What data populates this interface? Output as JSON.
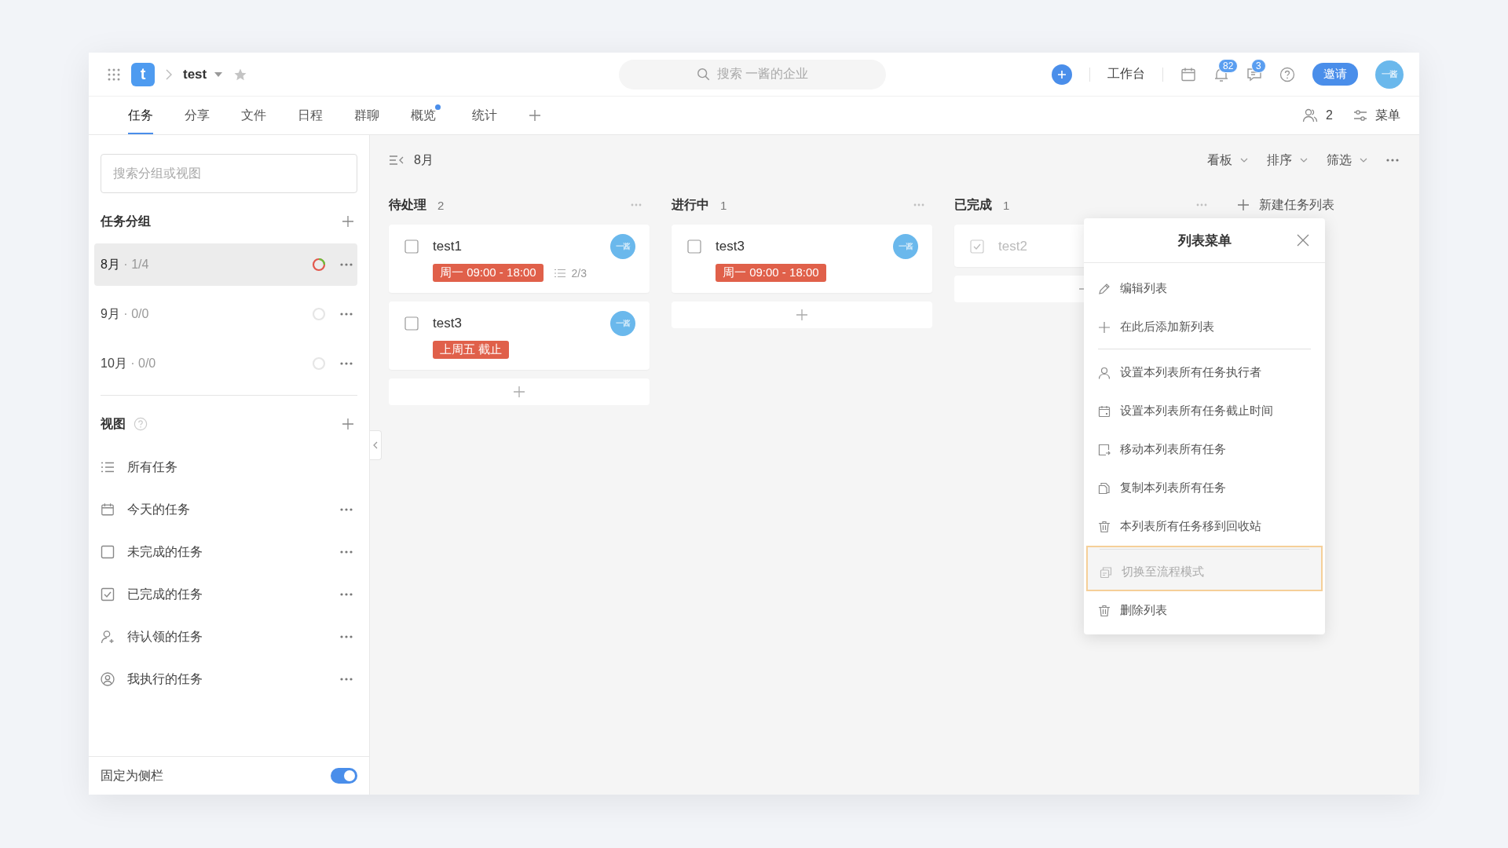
{
  "topbar": {
    "logo": "t",
    "project": "test",
    "search_placeholder": "搜索 一酱的企业",
    "workbench": "工作台",
    "notifications_badge": "82",
    "messages_badge": "3",
    "invite": "邀请",
    "avatar": "一酱"
  },
  "tabs": [
    {
      "label": "任务",
      "selected": true,
      "dot": false
    },
    {
      "label": "分享",
      "selected": false,
      "dot": false
    },
    {
      "label": "文件",
      "selected": false,
      "dot": false
    },
    {
      "label": "日程",
      "selected": false,
      "dot": false
    },
    {
      "label": "群聊",
      "selected": false,
      "dot": false
    },
    {
      "label": "概览",
      "selected": false,
      "dot": true
    },
    {
      "label": "统计",
      "selected": false,
      "dot": false
    }
  ],
  "members_count": "2",
  "menu_label": "菜单",
  "sidebar": {
    "search_placeholder": "搜索分组或视图",
    "groups_title": "任务分组",
    "groups": [
      {
        "name": "8月",
        "count": " · 1/4",
        "selected": true,
        "level": 0.25
      },
      {
        "name": "9月",
        "count": " · 0/0",
        "selected": false,
        "level": 0
      },
      {
        "name": "10月",
        "count": " · 0/0",
        "selected": false,
        "level": 0
      }
    ],
    "views_title": "视图",
    "views": [
      {
        "label": "所有任务",
        "kind": "list",
        "more": false
      },
      {
        "label": "今天的任务",
        "kind": "calendar",
        "more": true
      },
      {
        "label": "未完成的任务",
        "kind": "unchecked",
        "more": true
      },
      {
        "label": "已完成的任务",
        "kind": "checked",
        "more": true
      },
      {
        "label": "待认领的任务",
        "kind": "claim",
        "more": true
      },
      {
        "label": "我执行的任务",
        "kind": "person",
        "more": true
      }
    ],
    "pin": {
      "label": "固定为侧栏",
      "on": true
    }
  },
  "board": {
    "title": "8月",
    "view": "看板",
    "sort": "排序",
    "filter": "筛选",
    "columns": [
      {
        "name": "待处理",
        "count": "2",
        "cards": [
          {
            "title": "test1",
            "done": false,
            "avatar": "一酱",
            "tag": "周一 09:00 - 18:00",
            "subtasks": "2/3"
          },
          {
            "title": "test3",
            "done": false,
            "avatar": "一酱",
            "tag": "上周五 截止"
          }
        ]
      },
      {
        "name": "进行中",
        "count": "1",
        "cards": [
          {
            "title": "test3",
            "done": false,
            "avatar": "一酱",
            "tag": "周一 09:00 - 18:00"
          }
        ]
      },
      {
        "name": "已完成",
        "count": "1",
        "cards": [
          {
            "title": "test2",
            "done": true
          }
        ]
      }
    ],
    "new_list": "新建任务列表"
  },
  "list_menu": {
    "title": "列表菜单",
    "items": [
      {
        "label": "编辑列表",
        "kind": "edit",
        "separated": false,
        "disabled": false,
        "focused": false
      },
      {
        "label": "在此后添加新列表",
        "kind": "add",
        "separated": false,
        "disabled": false,
        "focused": false
      },
      {
        "label": "设置本列表所有任务执行者",
        "kind": "person",
        "separated": true,
        "disabled": false,
        "focused": false
      },
      {
        "label": "设置本列表所有任务截止时间",
        "kind": "calendar",
        "separated": false,
        "disabled": false,
        "focused": false
      },
      {
        "label": "移动本列表所有任务",
        "kind": "move",
        "separated": false,
        "disabled": false,
        "focused": false
      },
      {
        "label": "复制本列表所有任务",
        "kind": "copy",
        "separated": false,
        "disabled": false,
        "focused": false
      },
      {
        "label": "本列表所有任务移到回收站",
        "kind": "trash",
        "separated": false,
        "disabled": false,
        "focused": false
      },
      {
        "label": "切换至流程模式",
        "kind": "flow",
        "separated": true,
        "disabled": true,
        "focused": true
      },
      {
        "label": "删除列表",
        "kind": "trash",
        "separated": false,
        "disabled": false,
        "focused": false
      }
    ]
  }
}
